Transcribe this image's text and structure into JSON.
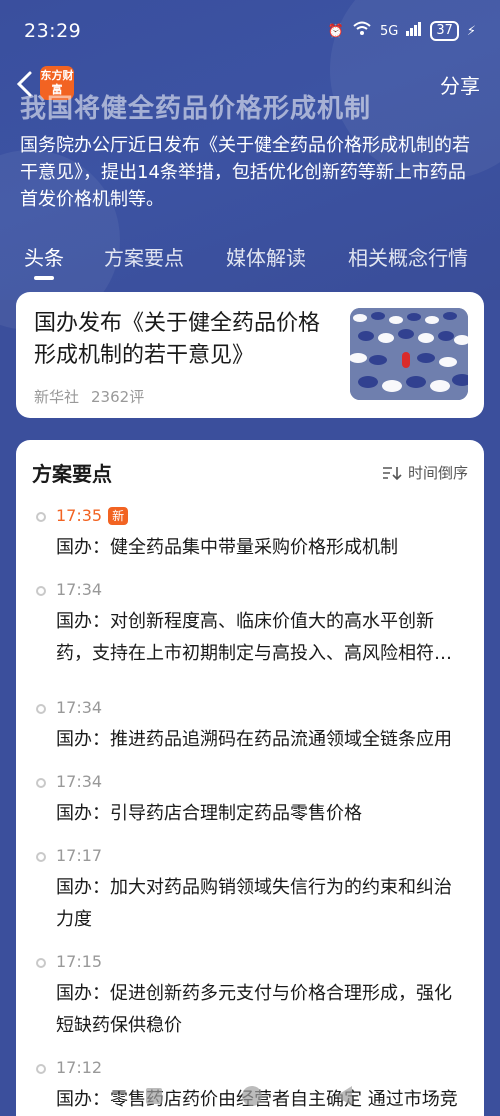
{
  "status_bar": {
    "time": "23:29",
    "signal_labels": [
      "6",
      "5G"
    ],
    "battery": "37"
  },
  "header": {
    "logo_text": "东方财富",
    "share_label": "分享",
    "title": "我国将健全药品价格形成机制",
    "summary": "国务院办公厅近日发布《关于健全药品价格形成机制的若干意见》，提出14条举措，包括优化创新药等新上市药品首发价格机制等。"
  },
  "tabs": [
    {
      "label": "头条"
    },
    {
      "label": "方案要点"
    },
    {
      "label": "媒体解读"
    },
    {
      "label": "相关概念行情"
    }
  ],
  "news_card": {
    "title": "国办发布《关于健全药品价格形成机制的若干意见》",
    "source": "新华社",
    "comments": "2362评"
  },
  "points": {
    "title": "方案要点",
    "sort_label": "时间倒序",
    "items": [
      {
        "time": "17:35",
        "badge": "新",
        "text": "国办：健全药品集中带量采购价格形成机制"
      },
      {
        "time": "17:34",
        "text": "国办：对创新程度高、临床价值大的高水平创新药，支持在上市初期制定与高投入、高风险相符…"
      },
      {
        "time": "17:34",
        "text": "国办：推进药品追溯码在药品流通领域全链条应用"
      },
      {
        "time": "17:34",
        "text": "国办：引导药店合理制定药品零售价格"
      },
      {
        "time": "17:17",
        "text": "国办：加大对药品购销领域失信行为的约束和纠治力度"
      },
      {
        "time": "17:15",
        "text": "国办：促进创新药多元支付与价格合理形成，强化短缺药保供稳价"
      },
      {
        "time": "17:12",
        "text": "国办：零售药店药价由经营者自主确定 通过市场竞争形成"
      }
    ]
  },
  "colors": {
    "header_bg": "#3b4f9c",
    "accent": "#f26322"
  }
}
